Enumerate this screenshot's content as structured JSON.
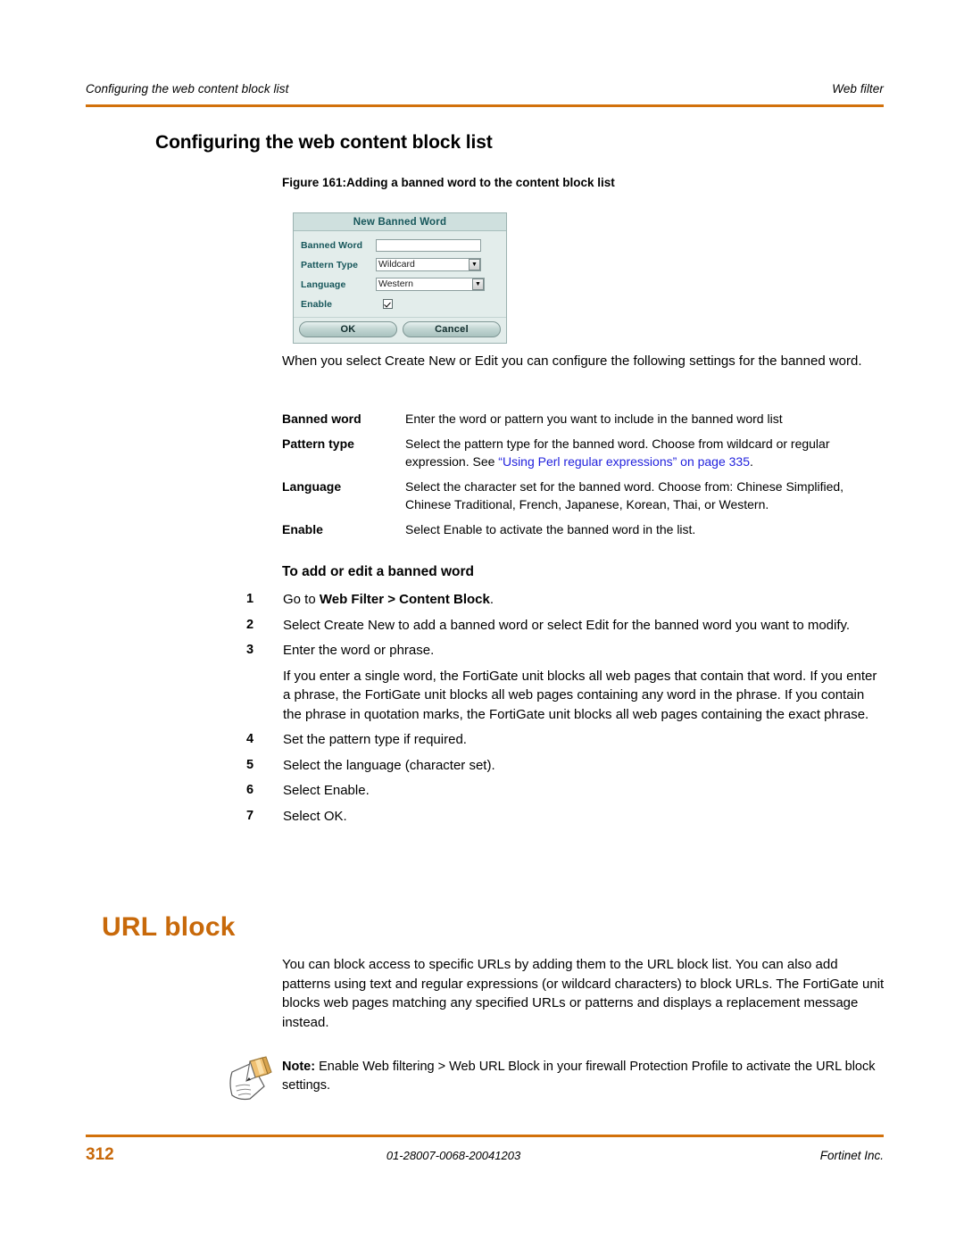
{
  "header": {
    "left": "Configuring the web content block list",
    "right": "Web filter",
    "rule_color": "#D2710B"
  },
  "section": {
    "title": "Configuring the web content block list"
  },
  "figure": {
    "caption": "Figure 161:Adding a banned word to the content block list",
    "dialog": {
      "title": "New Banned Word",
      "fields": [
        {
          "label": "Banned Word",
          "type": "text",
          "value": ""
        },
        {
          "label": "Pattern Type",
          "type": "select",
          "value": "Wildcard"
        },
        {
          "label": "Language",
          "type": "select",
          "value": "Western"
        },
        {
          "label": "Enable",
          "type": "checkbox",
          "checked": true
        }
      ],
      "ok_label": "OK",
      "cancel_label": "Cancel"
    }
  },
  "intro": {
    "paragraph": "When you select Create New or Edit you can configure the following settings for the banned word."
  },
  "definitions": [
    {
      "term": "Banned word",
      "desc": "Enter the word or pattern you want to include in the banned word list"
    },
    {
      "term": "Pattern type",
      "desc_pre": "Select the pattern type for the banned word. Choose from wildcard or regular expression. See ",
      "link": "“Using Perl regular expressions” on page 335",
      "desc_post": "."
    },
    {
      "term": "Language",
      "desc": "Select the character set for the banned word. Choose from: Chinese Simplified, Chinese Traditional, French, Japanese, Korean, Thai, or Western."
    },
    {
      "term": "Enable",
      "desc": "Select Enable to activate the banned word in the list."
    }
  ],
  "procedure": {
    "heading": "To add or edit a banned word",
    "steps": [
      {
        "num": "1",
        "pre": "Go to ",
        "bold": "Web Filter > Content Block",
        "post": "."
      },
      {
        "num": "2",
        "text": "Select Create New to add a banned word or select Edit for the banned word you want to modify."
      },
      {
        "num": "3",
        "text": "Enter the word or phrase.",
        "sub": "If you enter a single word, the FortiGate unit blocks all web pages that contain that word. If you enter a phrase, the FortiGate unit blocks all web pages containing any word in the phrase. If you contain the phrase in quotation marks, the FortiGate unit blocks all web pages containing the exact phrase."
      },
      {
        "num": "4",
        "text": "Set the pattern type if required."
      },
      {
        "num": "5",
        "text": "Select the language (character set)."
      },
      {
        "num": "6",
        "text": "Select Enable."
      },
      {
        "num": "7",
        "text": "Select OK."
      }
    ]
  },
  "chapter": {
    "heading": "URL block",
    "heading_color": "#C8690A",
    "paragraph": "You can block access to specific URLs by adding them to the URL block list. You can also add patterns using text and regular expressions (or wildcard characters) to block URLs. The FortiGate unit blocks web pages matching any specified URLs or patterns and displays a replacement message instead."
  },
  "note": {
    "icon": "note-pencil-paper-icon",
    "label": "Note:",
    "text": " Enable Web filtering > Web URL Block in your firewall Protection Profile to activate the URL block settings."
  },
  "footer": {
    "page_number": "312",
    "document_id": "01-28007-0068-20041203",
    "company": "Fortinet Inc.",
    "page_color": "#C8690A"
  }
}
